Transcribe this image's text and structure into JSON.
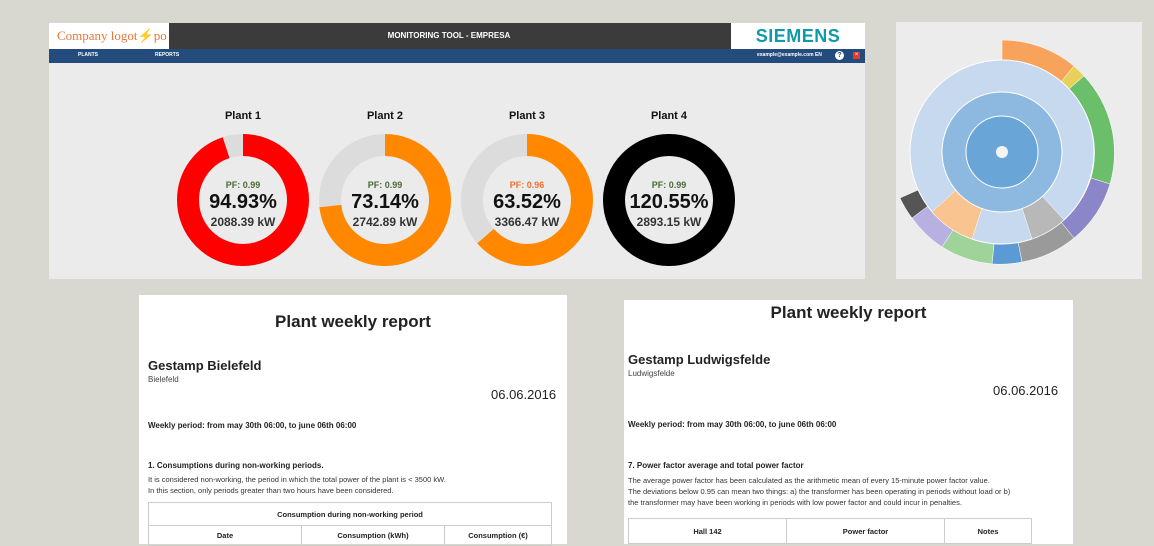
{
  "dashboard": {
    "logo": "Company logot⚡po",
    "title": "MONITORING TOOL - EMPRESA",
    "brand": "SIEMENS",
    "nav": [
      "PLANTS",
      "REPORTS"
    ],
    "user_email": "example@example.com",
    "language": "EN",
    "help_icon": "?",
    "close_icon": "×",
    "plants": [
      {
        "name": "Plant 1",
        "pf": "PF: 0.99",
        "pct": "94.93%",
        "kw": "2088.39 kW",
        "fill": 0.9493,
        "color": "#ff0000",
        "pf_color": "#4a6a3a"
      },
      {
        "name": "Plant 2",
        "pf": "PF: 0.99",
        "pct": "73.14%",
        "kw": "2742.89 kW",
        "fill": 0.7314,
        "color": "#ff8800",
        "pf_color": "#4a6a3a"
      },
      {
        "name": "Plant 3",
        "pf": "PF: 0.96",
        "pct": "63.52%",
        "kw": "3366.47 kW",
        "fill": 0.6352,
        "color": "#ff8800",
        "pf_color": "#f07030"
      },
      {
        "name": "Plant 4",
        "pf": "PF: 0.99",
        "pct": "120.55%",
        "kw": "2893.15 kW",
        "fill": 1.0,
        "color": "#000000",
        "pf_color": "#4a6a3a"
      }
    ]
  },
  "report1": {
    "title": "Plant weekly report",
    "plant": "Gestamp Bielefeld",
    "city": "Bielefeld",
    "date": "06.06.2016",
    "period": "Weekly period: from may 30th 06:00, to june 06th 06:00",
    "section": "1. Consumptions during non-working periods.",
    "text1": "It is considered non-working, the period in which the total power of the plant is < 3500 kW.",
    "text2": "In this section, only periods greater than two hours have been considered.",
    "table_title": "Consumption during non-working period",
    "columns": [
      "Date",
      "Consumption (kWh)",
      "Consumption (€)"
    ]
  },
  "report2": {
    "title": "Plant weekly report",
    "plant": "Gestamp Ludwigsfelde",
    "city": "Ludwigsfelde",
    "date": "06.06.2016",
    "period": "Weekly period: from may 30th 06:00, to june 06th 06:00",
    "section": "7. Power factor average and total power factor",
    "text1": "The average power factor has been calculated as the arithmetic mean of every 15-minute power factor value.",
    "text2": "The deviations below 0.95 can mean two things: a) the transformer has been operating in periods without load or b)",
    "text3": "the transformer may have been working in periods with low power factor and could incur in penalties.",
    "columns": [
      "Hall 142",
      "Power factor",
      "Notes"
    ]
  }
}
